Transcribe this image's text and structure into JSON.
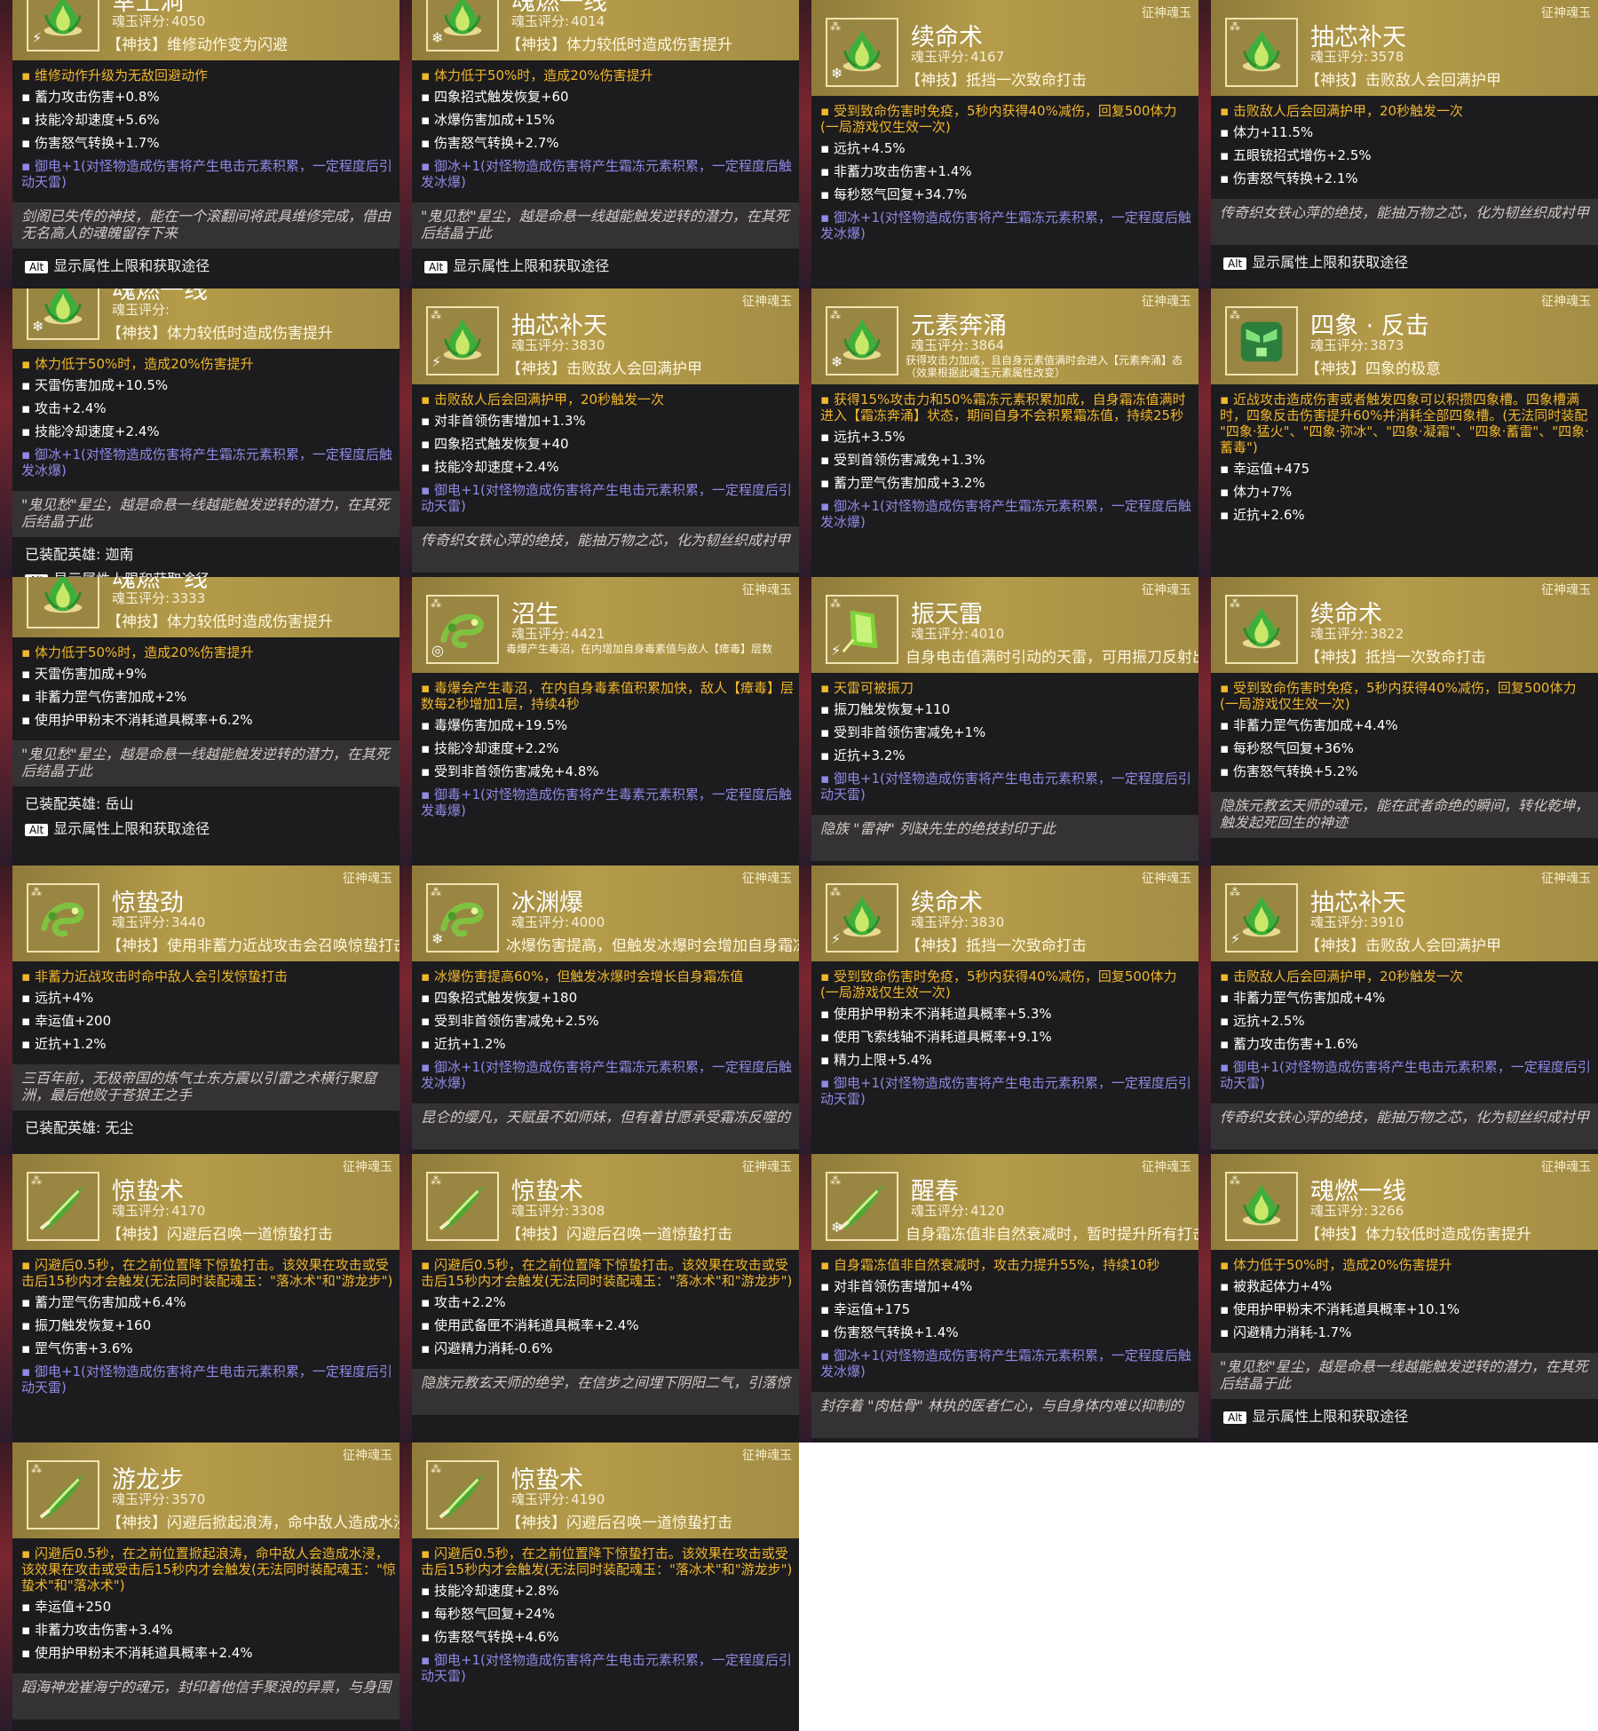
{
  "common": {
    "rank": "征神魂玉",
    "score_label": "魂玉评分:",
    "alt_key": "Alt",
    "alt_text": "显示属性上限和获取途径"
  },
  "cards": [
    {
      "title": "幸上洞",
      "score": "4050",
      "skill": "【神技】维修动作变为闪避",
      "icon": "flame",
      "elem": "⚡",
      "effect": "维修动作升级为无敌回避动作",
      "stats": [
        "蓄力攻击伤害+0.8%",
        "技能冷却速度+5.6%",
        "伤害怒气转换+1.7%"
      ],
      "ench": "御电+1(对怪物造成伤害将产生电击元素积累，一定程度后引动天雷)",
      "lore": "剑阁已失传的神技，能在一个滚翻间将武具维修完成，借由无名高人的魂魄留存下来",
      "equipped": "",
      "alt": true,
      "cut": true
    },
    {
      "title": "魂燃一线",
      "score": "4014",
      "skill": "【神技】体力较低时造成伤害提升",
      "icon": "flame",
      "elem": "❄",
      "effect": "体力低于50%时，造成20%伤害提升",
      "stats": [
        "四象招式触发恢复+60",
        "冰爆伤害加成+15%",
        "伤害怒气转换+2.7%"
      ],
      "ench": "御冰+1(对怪物造成伤害将产生霜冻元素积累，一定程度后触发冰爆)",
      "lore": "\"鬼见愁\"星尘，越是命悬一线越能触发逆转的潜力，在其死后结晶于此",
      "equipped": "",
      "alt": true,
      "cut": true
    },
    {
      "title": "续命术",
      "score": "4167",
      "skill": "【神技】抵挡一次致命打击",
      "icon": "flame",
      "elem": "❄",
      "effect": "受到致命伤害时免疫，5秒内获得40%减伤，回复500体力(一局游戏仅生效一次)",
      "stats": [
        "远抗+4.5%",
        "非蓄力攻击伤害+1.4%",
        "每秒怒气回复+34.7%"
      ],
      "ench": "御冰+1(对怪物造成伤害将产生霜冻元素积累，一定程度后触发冰爆)",
      "lore": "",
      "equipped": "",
      "alt": false,
      "cut": false
    },
    {
      "title": "抽芯补天",
      "score": "3578",
      "skill": "【神技】击败敌人会回满护甲",
      "icon": "flame",
      "elem": "",
      "effect": "击败敌人后会回满护甲，20秒触发一次",
      "stats": [
        "体力+11.5%",
        "五眼铳招式增伤+2.5%",
        "伤害怒气转换+2.1%"
      ],
      "ench": "",
      "lore": "传奇织女铁心萍的绝技，能抽万物之芯，化为韧丝织成衬甲",
      "equipped": "",
      "alt": true,
      "cut": false
    },
    {
      "title": "魂燃一线",
      "score": "",
      "skill": "【神技】体力较低时造成伤害提升",
      "icon": "flame",
      "elem": "❄",
      "effect": "体力低于50%时，造成20%伤害提升",
      "stats": [
        "天雷伤害加成+10.5%",
        "攻击+2.4%",
        "技能冷却速度+2.4%"
      ],
      "ench": "御冰+1(对怪物造成伤害将产生霜冻元素积累，一定程度后触发冰爆)",
      "lore": "\"鬼见愁\"星尘，越是命悬一线越能触发逆转的潜力，在其死后结晶于此",
      "equipped": "已装配英雄: 迦南",
      "alt": true,
      "cut": true
    },
    {
      "title": "抽芯补天",
      "score": "3830",
      "skill": "【神技】击败敌人会回满护甲",
      "icon": "flame",
      "elem": "⚡",
      "effect": "击败敌人后会回满护甲，20秒触发一次",
      "stats": [
        "对非首领伤害增加+1.3%",
        "四象招式触发恢复+40",
        "技能冷却速度+2.4%"
      ],
      "ench": "御电+1(对怪物造成伤害将产生电击元素积累，一定程度后引动天雷)",
      "lore": "传奇织女铁心萍的绝技，能抽万物之芯，化为韧丝织成衬甲",
      "equipped": "",
      "alt": false,
      "cut": false
    },
    {
      "title": "元素奔涌",
      "score": "3864",
      "skill": "获得攻击力加成，且自身元素值满时会进入【元素奔涌】态（效果根据此魂玉元素属性改变）",
      "icon": "flame",
      "elem": "❄",
      "small": true,
      "effect": "获得15%攻击力和50%霜冻元素积累加成，自身霜冻值满时进入【霜冻奔涌】状态，期间自身不会积累霜冻值，持续25秒",
      "stats": [
        "远抗+3.5%",
        "受到首领伤害减免+1.3%",
        "蓄力罡气伤害加成+3.2%"
      ],
      "ench": "御冰+1(对怪物造成伤害将产生霜冻元素积累，一定程度后触发冰爆)",
      "lore": "",
      "equipped": "",
      "alt": false,
      "cut": false
    },
    {
      "title": "四象 · 反击",
      "score": "3873",
      "skill": "【神技】四象的极意",
      "icon": "mask",
      "elem": "",
      "effect": "近战攻击造成伤害或者触发四象可以积攒四象槽。四象槽满时，四象反击伤害提升60%并消耗全部四象槽。(无法同时装配 \"四象·猛火\"、\"四象·弥冰\"、\"四象·凝霜\"、\"四象·蓄雷\"、\"四象·蓄毒\")",
      "stats": [
        "幸运值+475",
        "体力+7%",
        "近抗+2.6%"
      ],
      "ench": "",
      "lore": "",
      "equipped": "",
      "alt": false,
      "cut": false
    },
    {
      "title": "魂燃一线",
      "score": "3333",
      "skill": "【神技】体力较低时造成伤害提升",
      "icon": "flame",
      "elem": "",
      "effect": "体力低于50%时，造成20%伤害提升",
      "stats": [
        "天雷伤害加成+9%",
        "非蓄力罡气伤害加成+2%",
        "使用护甲粉末不消耗道具概率+6.2%"
      ],
      "ench": "",
      "lore": "\"鬼见愁\"星尘，越是命悬一线越能触发逆转的潜力，在其死后结晶于此",
      "equipped": "已装配英雄: 岳山",
      "alt": true,
      "cut": true
    },
    {
      "title": "沼生",
      "score": "4421",
      "skill": "毒爆产生毒沼，在内增加自身毒素值与敌人【瘴毒】层数",
      "icon": "dragon",
      "elem": "◎",
      "small": true,
      "effect": "毒爆会产生毒沼，在内自身毒素值积累加快，敌人【瘴毒】层数每2秒增加1层，持续4秒",
      "stats": [
        "毒爆伤害加成+19.5%",
        "技能冷却速度+2.2%",
        "受到非首领伤害减免+4.8%"
      ],
      "ench": "御毒+1(对怪物造成伤害将产生毒素元素积累，一定程度后触发毒爆)",
      "lore": "",
      "equipped": "",
      "alt": false,
      "cut": false
    },
    {
      "title": "振天雷",
      "score": "4010",
      "skill": "自身电击值满时引动的天雷，可用振刀反射出去",
      "icon": "crystal",
      "elem": "⚡",
      "effect": "天雷可被振刀",
      "stats": [
        "振刀触发恢复+110",
        "受到非首领伤害减免+1%",
        "近抗+3.2%"
      ],
      "ench": "御电+1(对怪物造成伤害将产生电击元素积累，一定程度后引动天雷)",
      "lore": "隐族 \"雷神\" 列缺先生的绝技封印于此",
      "equipped": "",
      "alt": false,
      "cut": false
    },
    {
      "title": "续命术",
      "score": "3822",
      "skill": "【神技】抵挡一次致命打击",
      "icon": "flame",
      "elem": "",
      "effect": "受到致命伤害时免疫，5秒内获得40%减伤，回复500体力(一局游戏仅生效一次)",
      "stats": [
        "非蓄力罡气伤害加成+4.4%",
        "每秒怒气回复+36%",
        "伤害怒气转换+5.2%"
      ],
      "ench": "",
      "lore": "隐族元教玄天师的魂元，能在武者命绝的瞬间，转化乾坤，触发起死回生的神迹",
      "equipped": "",
      "alt": false,
      "cut": false
    },
    {
      "title": "惊蛰劲",
      "score": "3440",
      "skill": "【神技】使用非蓄力近战攻击会召唤惊蛰打击",
      "icon": "dragon",
      "elem": "",
      "effect": "非蓄力近战攻击时命中敌人会引发惊蛰打击",
      "stats": [
        "远抗+4%",
        "幸运值+200",
        "近抗+1.2%"
      ],
      "ench": "",
      "lore": "三百年前，无极帝国的炼气士东方震以引雷之术横行聚窟洲，最后他败于苍狼王之手",
      "equipped": "已装配英雄: 无尘",
      "alt": false,
      "cut": false
    },
    {
      "title": "冰渊爆",
      "score": "4000",
      "skill": "冰爆伤害提高，但触发冰爆时会增加自身霜冻值",
      "icon": "dragon",
      "elem": "❄",
      "effect": "冰爆伤害提高60%，但触发冰爆时会增长自身霜冻值",
      "stats": [
        "四象招式触发恢复+180",
        "受到非首领伤害减免+2.5%",
        "近抗+1.2%"
      ],
      "ench": "御冰+1(对怪物造成伤害将产生霜冻元素积累，一定程度后触发冰爆)",
      "lore": "昆仑的缨凡，天赋虽不如师妹，但有着甘愿承受霜冻反噬的",
      "equipped": "",
      "alt": false,
      "cut": false
    },
    {
      "title": "续命术",
      "score": "3830",
      "skill": "【神技】抵挡一次致命打击",
      "icon": "flame",
      "elem": "⚡",
      "effect": "受到致命伤害时免疫，5秒内获得40%减伤，回复500体力(一局游戏仅生效一次)",
      "stats": [
        "使用护甲粉末不消耗道具概率+5.3%",
        "使用飞索线轴不消耗道具概率+9.1%",
        "精力上限+5.4%"
      ],
      "ench": "御电+1(对怪物造成伤害将产生电击元素积累，一定程度后引动天雷)",
      "lore": "",
      "equipped": "",
      "alt": false,
      "cut": false
    },
    {
      "title": "抽芯补天",
      "score": "3910",
      "skill": "【神技】击败敌人会回满护甲",
      "icon": "flame",
      "elem": "⚡",
      "effect": "击败敌人后会回满护甲，20秒触发一次",
      "stats": [
        "非蓄力罡气伤害加成+4%",
        "远抗+2.5%",
        "蓄力攻击伤害+1.6%"
      ],
      "ench": "御电+1(对怪物造成伤害将产生电击元素积累，一定程度后引动天雷)",
      "lore": "传奇织女铁心萍的绝技，能抽万物之芯，化为韧丝织成衬甲",
      "equipped": "",
      "alt": false,
      "cut": false
    },
    {
      "title": "惊蛰术",
      "score": "4170",
      "skill": "【神技】闪避后召唤一道惊蛰打击",
      "icon": "blade",
      "elem": "",
      "effect": "闪避后0.5秒，在之前位置降下惊蛰打击。该效果在攻击或受击后15秒内才会触发(无法同时装配魂玉：\"落冰术\"和\"游龙步\")",
      "stats": [
        "蓄力罡气伤害加成+6.4%",
        "振刀触发恢复+160",
        "罡气伤害+3.6%"
      ],
      "ench": "御电+1(对怪物造成伤害将产生电击元素积累，一定程度后引动天雷)",
      "lore": "",
      "equipped": "",
      "alt": false,
      "cut": false
    },
    {
      "title": "惊蛰术",
      "score": "3308",
      "skill": "【神技】闪避后召唤一道惊蛰打击",
      "icon": "blade",
      "elem": "",
      "effect": "闪避后0.5秒，在之前位置降下惊蛰打击。该效果在攻击或受击后15秒内才会触发(无法同时装配魂玉：\"落冰术\"和\"游龙步\")",
      "stats": [
        "攻击+2.2%",
        "使用武备匣不消耗道具概率+2.4%",
        "闪避精力消耗-0.6%"
      ],
      "ench": "",
      "lore": "隐族元教玄天师的绝学，在信步之间埋下阴阳二气，引落惊",
      "equipped": "",
      "alt": false,
      "cut": false
    },
    {
      "title": "醒春",
      "score": "4120",
      "skill": "自身霜冻值非自然衰减时，暂时提升所有打击伤害",
      "icon": "blade",
      "elem": "❄",
      "effect": "自身霜冻值非自然衰减时，攻击力提升55%，持续10秒",
      "stats": [
        "对非首领伤害增加+4%",
        "幸运值+175",
        "伤害怒气转换+1.4%"
      ],
      "ench": "御冰+1(对怪物造成伤害将产生霜冻元素积累，一定程度后触发冰爆)",
      "lore": "封存着 \"肉枯骨\" 林执的医者仁心，与自身体内难以抑制的",
      "equipped": "",
      "alt": false,
      "cut": false
    },
    {
      "title": "魂燃一线",
      "score": "3266",
      "skill": "【神技】体力较低时造成伤害提升",
      "icon": "flame",
      "elem": "",
      "effect": "体力低于50%时，造成20%伤害提升",
      "stats": [
        "被救起体力+4%",
        "使用护甲粉末不消耗道具概率+10.1%",
        "闪避精力消耗-1.7%"
      ],
      "ench": "",
      "lore": "\"鬼见愁\"星尘，越是命悬一线越能触发逆转的潜力，在其死后结晶于此",
      "equipped": "",
      "alt": true,
      "cut": false
    },
    {
      "title": "游龙步",
      "score": "3570",
      "skill": "【神技】闪避后掀起浪涛，命中敌人造成水浸",
      "icon": "blade",
      "elem": "",
      "effect": "闪避后0.5秒，在之前位置掀起浪涛，命中敌人会造成水浸，该效果在攻击或受击后15秒内才会触发(无法同时装配魂玉：\"惊蛰术\"和\"落冰术\")",
      "stats": [
        "幸运值+250",
        "非蓄力攻击伤害+3.4%",
        "使用护甲粉末不消耗道具概率+2.4%"
      ],
      "ench": "",
      "lore": "蹈海神龙崔海宁的魂元，封印着他信手聚浪的异禀，与身围",
      "equipped": "",
      "alt": false,
      "cut": false
    },
    {
      "title": "惊蛰术",
      "score": "4190",
      "skill": "【神技】闪避后召唤一道惊蛰打击",
      "icon": "blade",
      "elem": "",
      "effect": "闪避后0.5秒，在之前位置降下惊蛰打击。该效果在攻击或受击后15秒内才会触发(无法同时装配魂玉：\"落冰术\"和\"游龙步\")",
      "stats": [
        "技能冷却速度+2.8%",
        "每秒怒气回复+24%",
        "伤害怒气转换+4.6%"
      ],
      "ench": "御电+1(对怪物造成伤害将产生电击元素积累，一定程度后引动天雷)",
      "lore": "",
      "equipped": "",
      "alt": false,
      "cut": false
    }
  ]
}
